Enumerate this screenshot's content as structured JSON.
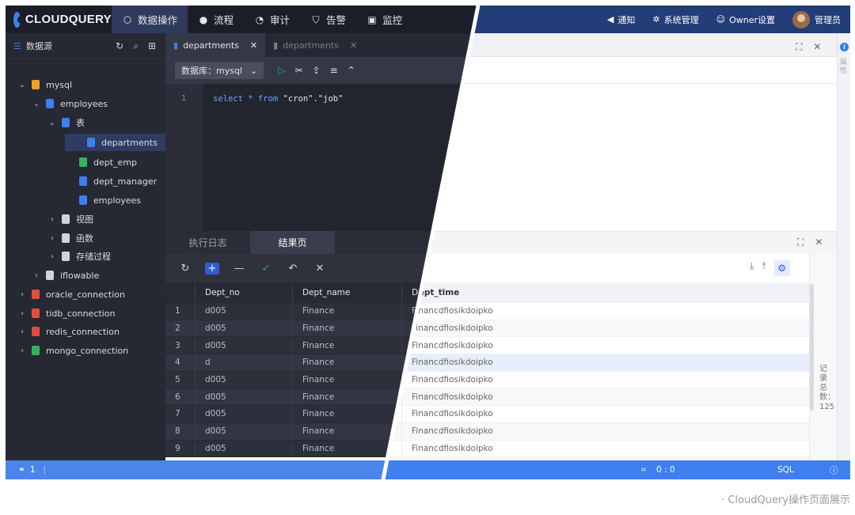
{
  "app": {
    "logo_text": "CLOUDQUERY"
  },
  "nav": {
    "items": [
      {
        "label": "数据操作",
        "icon": "share-nodes-icon"
      },
      {
        "label": "流程",
        "icon": "user-icon"
      },
      {
        "label": "审计",
        "icon": "pie-icon"
      },
      {
        "label": "告警",
        "icon": "shield-icon"
      },
      {
        "label": "监控",
        "icon": "monitor-icon"
      }
    ],
    "right": {
      "notify": "通知",
      "system": "系统管理",
      "owner": "Owner设置",
      "user": "管理员"
    }
  },
  "sidebar": {
    "title": "数据源",
    "tree": [
      {
        "label": "mysql",
        "level": 0,
        "expanded": true,
        "color": "#f0a020"
      },
      {
        "label": "employees",
        "level": 1,
        "expanded": true,
        "color": "#3d7ef0"
      },
      {
        "label": "表",
        "level": 2,
        "expanded": true,
        "color": "#3d7ef0"
      },
      {
        "label": "departments",
        "level": 3,
        "selected": true,
        "color": "#3d7ef0"
      },
      {
        "label": "dept_emp",
        "level": 3,
        "color": "#2db55d"
      },
      {
        "label": "dept_manager",
        "level": 3,
        "color": "#3d7ef0"
      },
      {
        "label": "employees",
        "level": 3,
        "color": "#3d7ef0"
      },
      {
        "label": "视图",
        "level": 2,
        "color": "#cfd3dc"
      },
      {
        "label": "函数",
        "level": 2,
        "color": "#cfd3dc"
      },
      {
        "label": "存储过程",
        "level": 2,
        "color": "#cfd3dc"
      },
      {
        "label": "iflowable",
        "level": 1,
        "color": "#cfd3dc"
      },
      {
        "label": "oracle_connection",
        "level": 0,
        "color": "#e54b3c"
      },
      {
        "label": "tidb_connection",
        "level": 0,
        "color": "#e54b3c"
      },
      {
        "label": "redis_connection",
        "level": 0,
        "color": "#e54b3c"
      },
      {
        "label": "mongo_connection",
        "level": 0,
        "color": "#2db55d"
      }
    ]
  },
  "editor": {
    "tabs": [
      "departments",
      "departments"
    ],
    "db_select": "数据库：mysql",
    "line_number": "1",
    "code": {
      "kw1": "select",
      "star": "*",
      "kw2": "from",
      "rest": "\"cron\".\"job\""
    }
  },
  "results": {
    "tabs": [
      "执行日志",
      "结果页"
    ],
    "columns": [
      "Dept_no",
      "Dept_name",
      "Dept_time"
    ],
    "rows": [
      [
        "1",
        "d005",
        "Finance",
        "Financdfiosikdoipko"
      ],
      [
        "2",
        "d005",
        "Finance",
        "Financdfiosikdoipko"
      ],
      [
        "3",
        "d005",
        "Finance",
        "Financdfiosikdoipko"
      ],
      [
        "4",
        "d",
        "Finance",
        "Financdfiosikdoipko"
      ],
      [
        "5",
        "d005",
        "Finance",
        "Financdfiosikdoipko"
      ],
      [
        "6",
        "d005",
        "Finance",
        "Financdfiosikdoipko"
      ],
      [
        "7",
        "d005",
        "Finance",
        "Financdfiosikdoipko"
      ],
      [
        "8",
        "d005",
        "Finance",
        "Financdfiosikdoipko"
      ],
      [
        "9",
        "d005",
        "Finance",
        "Financdfiosikdoipko"
      ]
    ],
    "record_count": "记录总数：125"
  },
  "right_strip": {
    "label": "属性"
  },
  "status": {
    "link_count": "1",
    "cursor": "0 : 0",
    "lang": "SQL"
  },
  "caption": "· CloudQuery操作页面展示",
  "colors": {
    "accent": "#3f7ff0",
    "nav_dark": "#1b1d28",
    "nav_light": "#223d78"
  }
}
